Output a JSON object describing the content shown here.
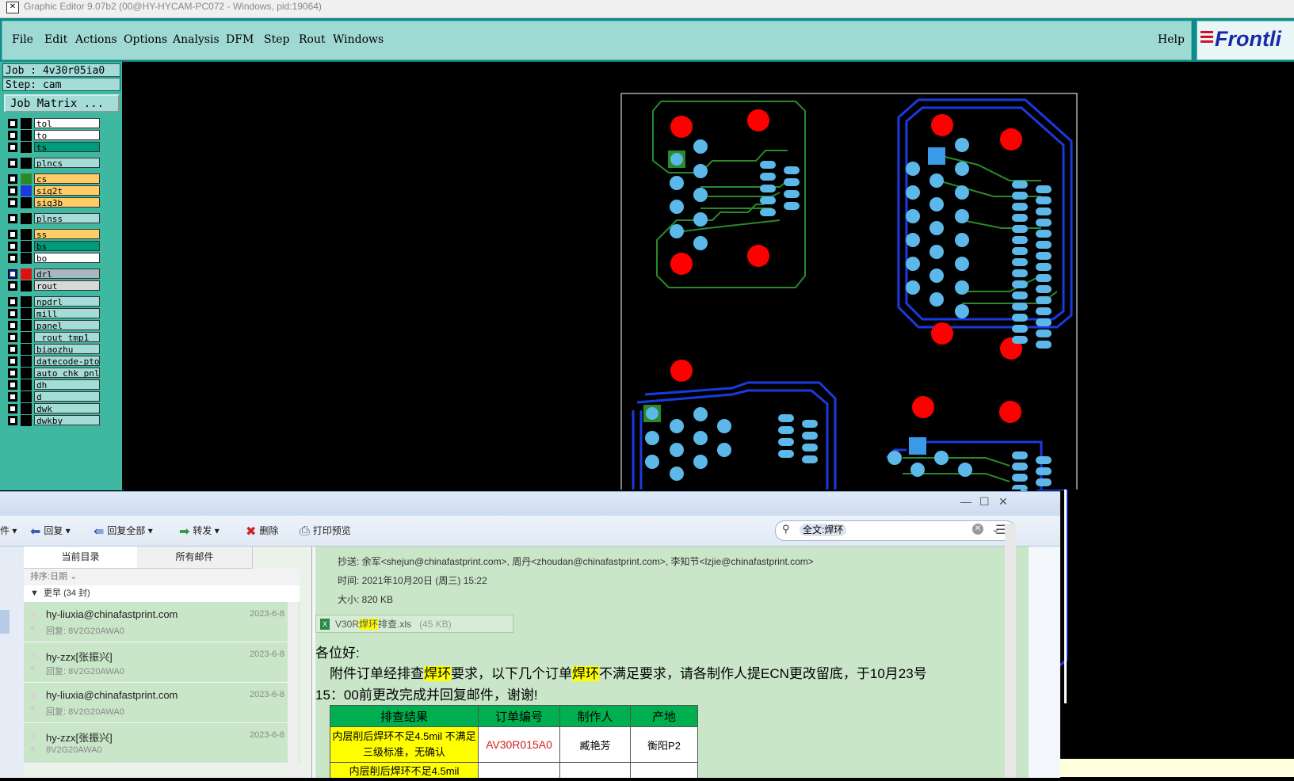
{
  "window": {
    "title": "Graphic Editor 9.07b2 (00@HY-HYCAM-PC072 - Windows, pid:19064)",
    "icon": "x-app-icon"
  },
  "menu": {
    "items": [
      "File",
      "Edit",
      "Actions",
      "Options",
      "Analysis",
      "DFM",
      "Step",
      "Rout",
      "Windows"
    ],
    "help": "Help",
    "logo_text": "Frontli"
  },
  "job": {
    "job": "Job : 4v30r05ia0",
    "step": "Step: cam",
    "matrix_button": "Job Matrix ..."
  },
  "layers": [
    {
      "name": "tol",
      "color": "#ffffff"
    },
    {
      "name": "to",
      "color": "#ffffff"
    },
    {
      "name": "ts",
      "color": "#009b7a"
    },
    {
      "name": "plncs",
      "color": "#a5dcd8"
    },
    {
      "name": "cs",
      "color": "#ffcc66",
      "swatch": "#2a8a2a"
    },
    {
      "name": "sig2t",
      "color": "#ffcc66",
      "swatch": "#1a3ae0"
    },
    {
      "name": "sig3b",
      "color": "#ffcc66"
    },
    {
      "name": "plnss",
      "color": "#a5dcd8"
    },
    {
      "name": "ss",
      "color": "#ffcc66"
    },
    {
      "name": "bs",
      "color": "#009b7a"
    },
    {
      "name": "bo",
      "color": "#ffffff"
    },
    {
      "name": "drl",
      "color": "#a8b8c0",
      "swatch": "#e01010",
      "active": true
    },
    {
      "name": "rout",
      "color": "#d8d8d8"
    },
    {
      "name": "npdrl",
      "color": "#a5dcd8"
    },
    {
      "name": "mill",
      "color": "#a5dcd8"
    },
    {
      "name": "panel",
      "color": "#a5dcd8"
    },
    {
      "name": "_rout_tmp1",
      "color": "#a5dcd8"
    },
    {
      "name": "biaozhu",
      "color": "#a5dcd8"
    },
    {
      "name": "datecode-pto",
      "color": "#a5dcd8"
    },
    {
      "name": "auto_chk_pnl",
      "color": "#a5dcd8"
    },
    {
      "name": "dh",
      "color": "#a5dcd8"
    },
    {
      "name": "d",
      "color": "#a5dcd8"
    },
    {
      "name": "dwk",
      "color": "#a5dcd8"
    },
    {
      "name": "dwkby",
      "color": "#a5dcd8"
    }
  ],
  "email": {
    "toolbar": {
      "file_frag": "件",
      "reply": "回复",
      "reply_all": "回复全部",
      "forward": "转发",
      "delete": "删除",
      "print_preview": "打印预览"
    },
    "search_value": "全文:焊环",
    "tabs": [
      "当前目录",
      "所有邮件"
    ],
    "sort": "排序:日期",
    "group": "更早 (34 封)",
    "messages": [
      {
        "from": "hy-liuxia@chinafastprint.com",
        "date": "2023-6-8",
        "subject": "回复: 8V2G20AWA0"
      },
      {
        "from": "hy-zzx[张振兴]",
        "date": "2023-6-8",
        "subject": "回复: 8V2G20AWA0"
      },
      {
        "from": "hy-liuxia@chinafastprint.com",
        "date": "2023-6-8",
        "subject": "回复: 8V2G20AWA0"
      },
      {
        "from": "hy-zzx[张振兴]",
        "date": "2023-6-8",
        "subject": "8V2G20AWA0"
      }
    ],
    "header": {
      "cc": "抄送: 余军<shejun@chinafastprint.com>, 周丹<zhoudan@chinafastprint.com>, 李知节<lzjie@chinafastprint.com>",
      "time": "时间: 2021年10月20日 (周三) 15:22",
      "size": "大小: 820 KB"
    },
    "attachment": {
      "prefix": "V30R",
      "highlight": "焊环",
      "suffix": "排查.xls",
      "size": "(45 KB)"
    },
    "body": {
      "greeting": "各位好:",
      "line1_a": "附件订单经排查",
      "line1_hl1": "焊环",
      "line1_b": "要求，以下几个订单",
      "line1_hl2": "焊环",
      "line1_c": "不满足要求，请各制作人提ECN更改留底，于10月23号",
      "line2": "15：00前更改完成并回复邮件，谢谢!"
    },
    "table": {
      "headers": [
        "排查结果",
        "订单编号",
        "制作人",
        "产地"
      ],
      "rows": [
        {
          "result": "内层削后焊环不足4.5mil 不满足三级标准，无确认",
          "order": "AV30R015A0",
          "maker": "臧艳芳",
          "site": "衡阳P2"
        },
        {
          "result": "内层削后焊环不足4.5mil",
          "order": "",
          "maker": "",
          "site": ""
        }
      ]
    }
  }
}
